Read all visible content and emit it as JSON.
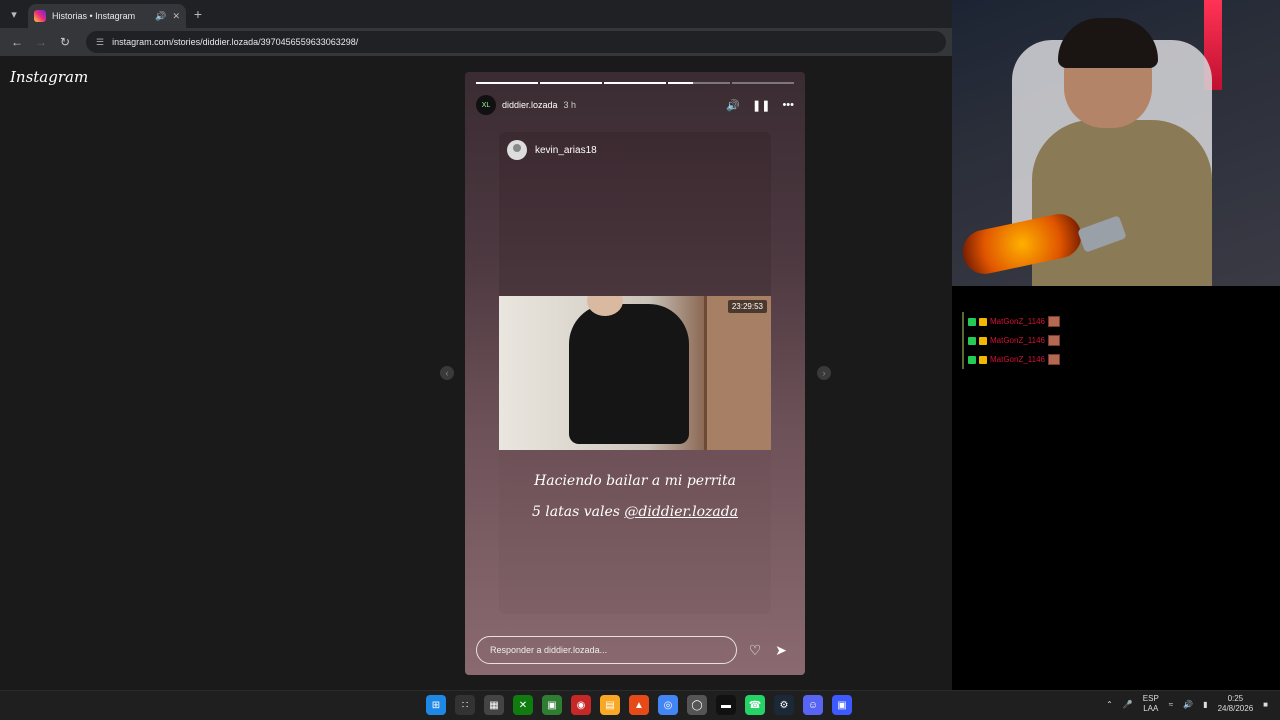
{
  "browser": {
    "tab_title": "Historias • Instagram",
    "url": "instagram.com/stories/diddier.lozada/3970456559633063298/"
  },
  "page": {
    "logo": "Instagram",
    "story": {
      "progress": [
        1.0,
        1.0,
        1.0,
        0.4,
        0.0
      ],
      "username": "diddier.lozada",
      "avatar_text": "XL",
      "time_ago": "3 h",
      "reposted_user": "kevin_arias18",
      "video_timer": "23:29:53",
      "caption_line1": "Haciendo bailar a mi perrita",
      "caption_line2_prefix": "5 latas vales ",
      "caption_mention": "@diddier.lozada",
      "reply_placeholder": "Responder a diddier.lozada..."
    }
  },
  "chat": {
    "rows": [
      {
        "name": "MatGonZ_1146"
      },
      {
        "name": "MatGonZ_1146"
      },
      {
        "name": "MatGonZ_1146"
      }
    ]
  },
  "taskbar": {
    "lang_top": "ESP",
    "lang_bottom": "LAA",
    "clock_time": "0:25",
    "clock_date": "24/8/2026"
  },
  "icons": {
    "volume": "volume-icon",
    "pause": "pause-icon",
    "more": "more-icon",
    "like": "heart-icon",
    "share": "send-icon"
  },
  "colors": {
    "chat_name": "#d41234",
    "story_top": "#3a2c32",
    "story_bottom": "#8a6a70"
  }
}
